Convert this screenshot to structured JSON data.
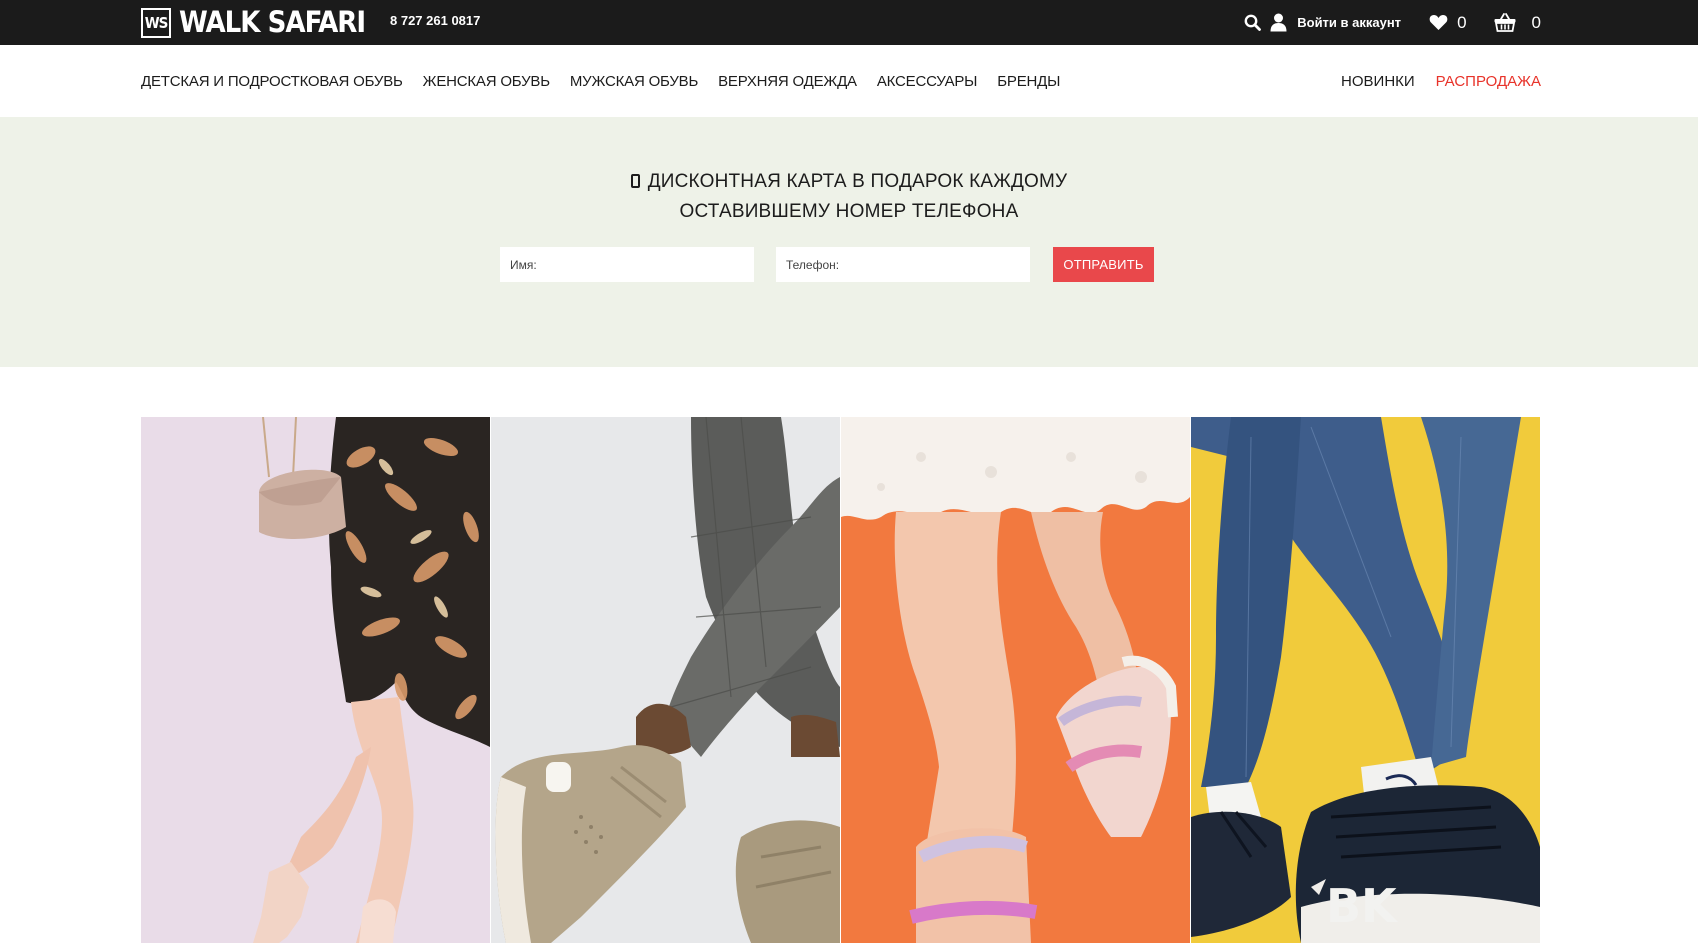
{
  "header": {
    "logo_mark": "WS",
    "logo_text": "WALK SAFARI",
    "phone": "8 727 261 0817",
    "login_label": "Войти в аккаунт",
    "favorites_count": "0",
    "cart_count": "0"
  },
  "nav": {
    "left": [
      {
        "label": "ДЕТСКАЯ И ПОДРОСТКОВАЯ ОБУВЬ"
      },
      {
        "label": "ЖЕНСКАЯ ОБУВЬ"
      },
      {
        "label": "МУЖСКАЯ ОБУВЬ"
      },
      {
        "label": "ВЕРХНЯЯ ОДЕЖДА"
      },
      {
        "label": "АКСЕССУАРЫ"
      },
      {
        "label": "БРЕНДЫ"
      }
    ],
    "right": [
      {
        "label": "НОВИНКИ"
      },
      {
        "label": "РАСПРОДАЖА"
      }
    ]
  },
  "promo": {
    "title_line1": "ДИСКОНТНАЯ КАРТА В ПОДАРОК КАЖДОМУ",
    "title_line2": "ОСТАВИВШЕМУ НОМЕР ТЕЛЕФОНА",
    "name_placeholder": "Имя:",
    "phone_placeholder": "Телефон:",
    "submit_label": "ОТПРАВИТЬ"
  },
  "colors": {
    "topbar": "#1b1b1b",
    "promo_bg": "#eef2e8",
    "accent_red": "#e9484b",
    "sale_red": "#e8332a"
  },
  "icons": [
    "search-icon",
    "user-icon",
    "heart-icon",
    "basket-icon",
    "phone-icon"
  ]
}
